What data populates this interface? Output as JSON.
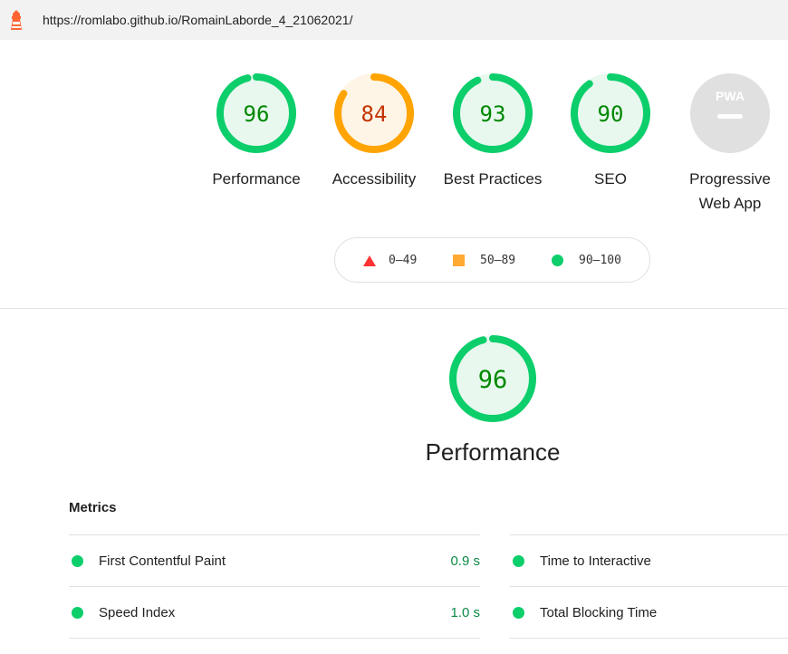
{
  "url": "https://romlabo.github.io/RomainLaborde_4_21062021/",
  "colors": {
    "pass": "#0cce6b",
    "pass_text": "#008800",
    "pass_fill": "#e8f8ef",
    "average": "#ffa400",
    "average_text": "#c33300",
    "average_fill": "#fff5e6",
    "fail": "#ff3333",
    "na": "#e0e0e0"
  },
  "gauges": [
    {
      "score": "96",
      "label": "Performance",
      "value": 96,
      "status": "pass"
    },
    {
      "score": "84",
      "label": "Accessibility",
      "value": 84,
      "status": "average"
    },
    {
      "score": "93",
      "label": "Best Practices",
      "value": 93,
      "status": "pass"
    },
    {
      "score": "90",
      "label": "SEO",
      "value": 90,
      "status": "pass"
    },
    {
      "score": "PWA",
      "label": "Progressive Web App",
      "value": null,
      "status": "na"
    }
  ],
  "legend": {
    "fail": "0–49",
    "average": "50–89",
    "pass": "90–100"
  },
  "performance": {
    "score": "96",
    "value": 96,
    "title": "Performance"
  },
  "metrics": {
    "heading": "Metrics",
    "items": [
      {
        "label": "First Contentful Paint",
        "value": "0.9 s"
      },
      {
        "label": "Time to Interactive",
        "value": ""
      },
      {
        "label": "Speed Index",
        "value": "1.0 s"
      },
      {
        "label": "Total Blocking Time",
        "value": ""
      }
    ]
  }
}
